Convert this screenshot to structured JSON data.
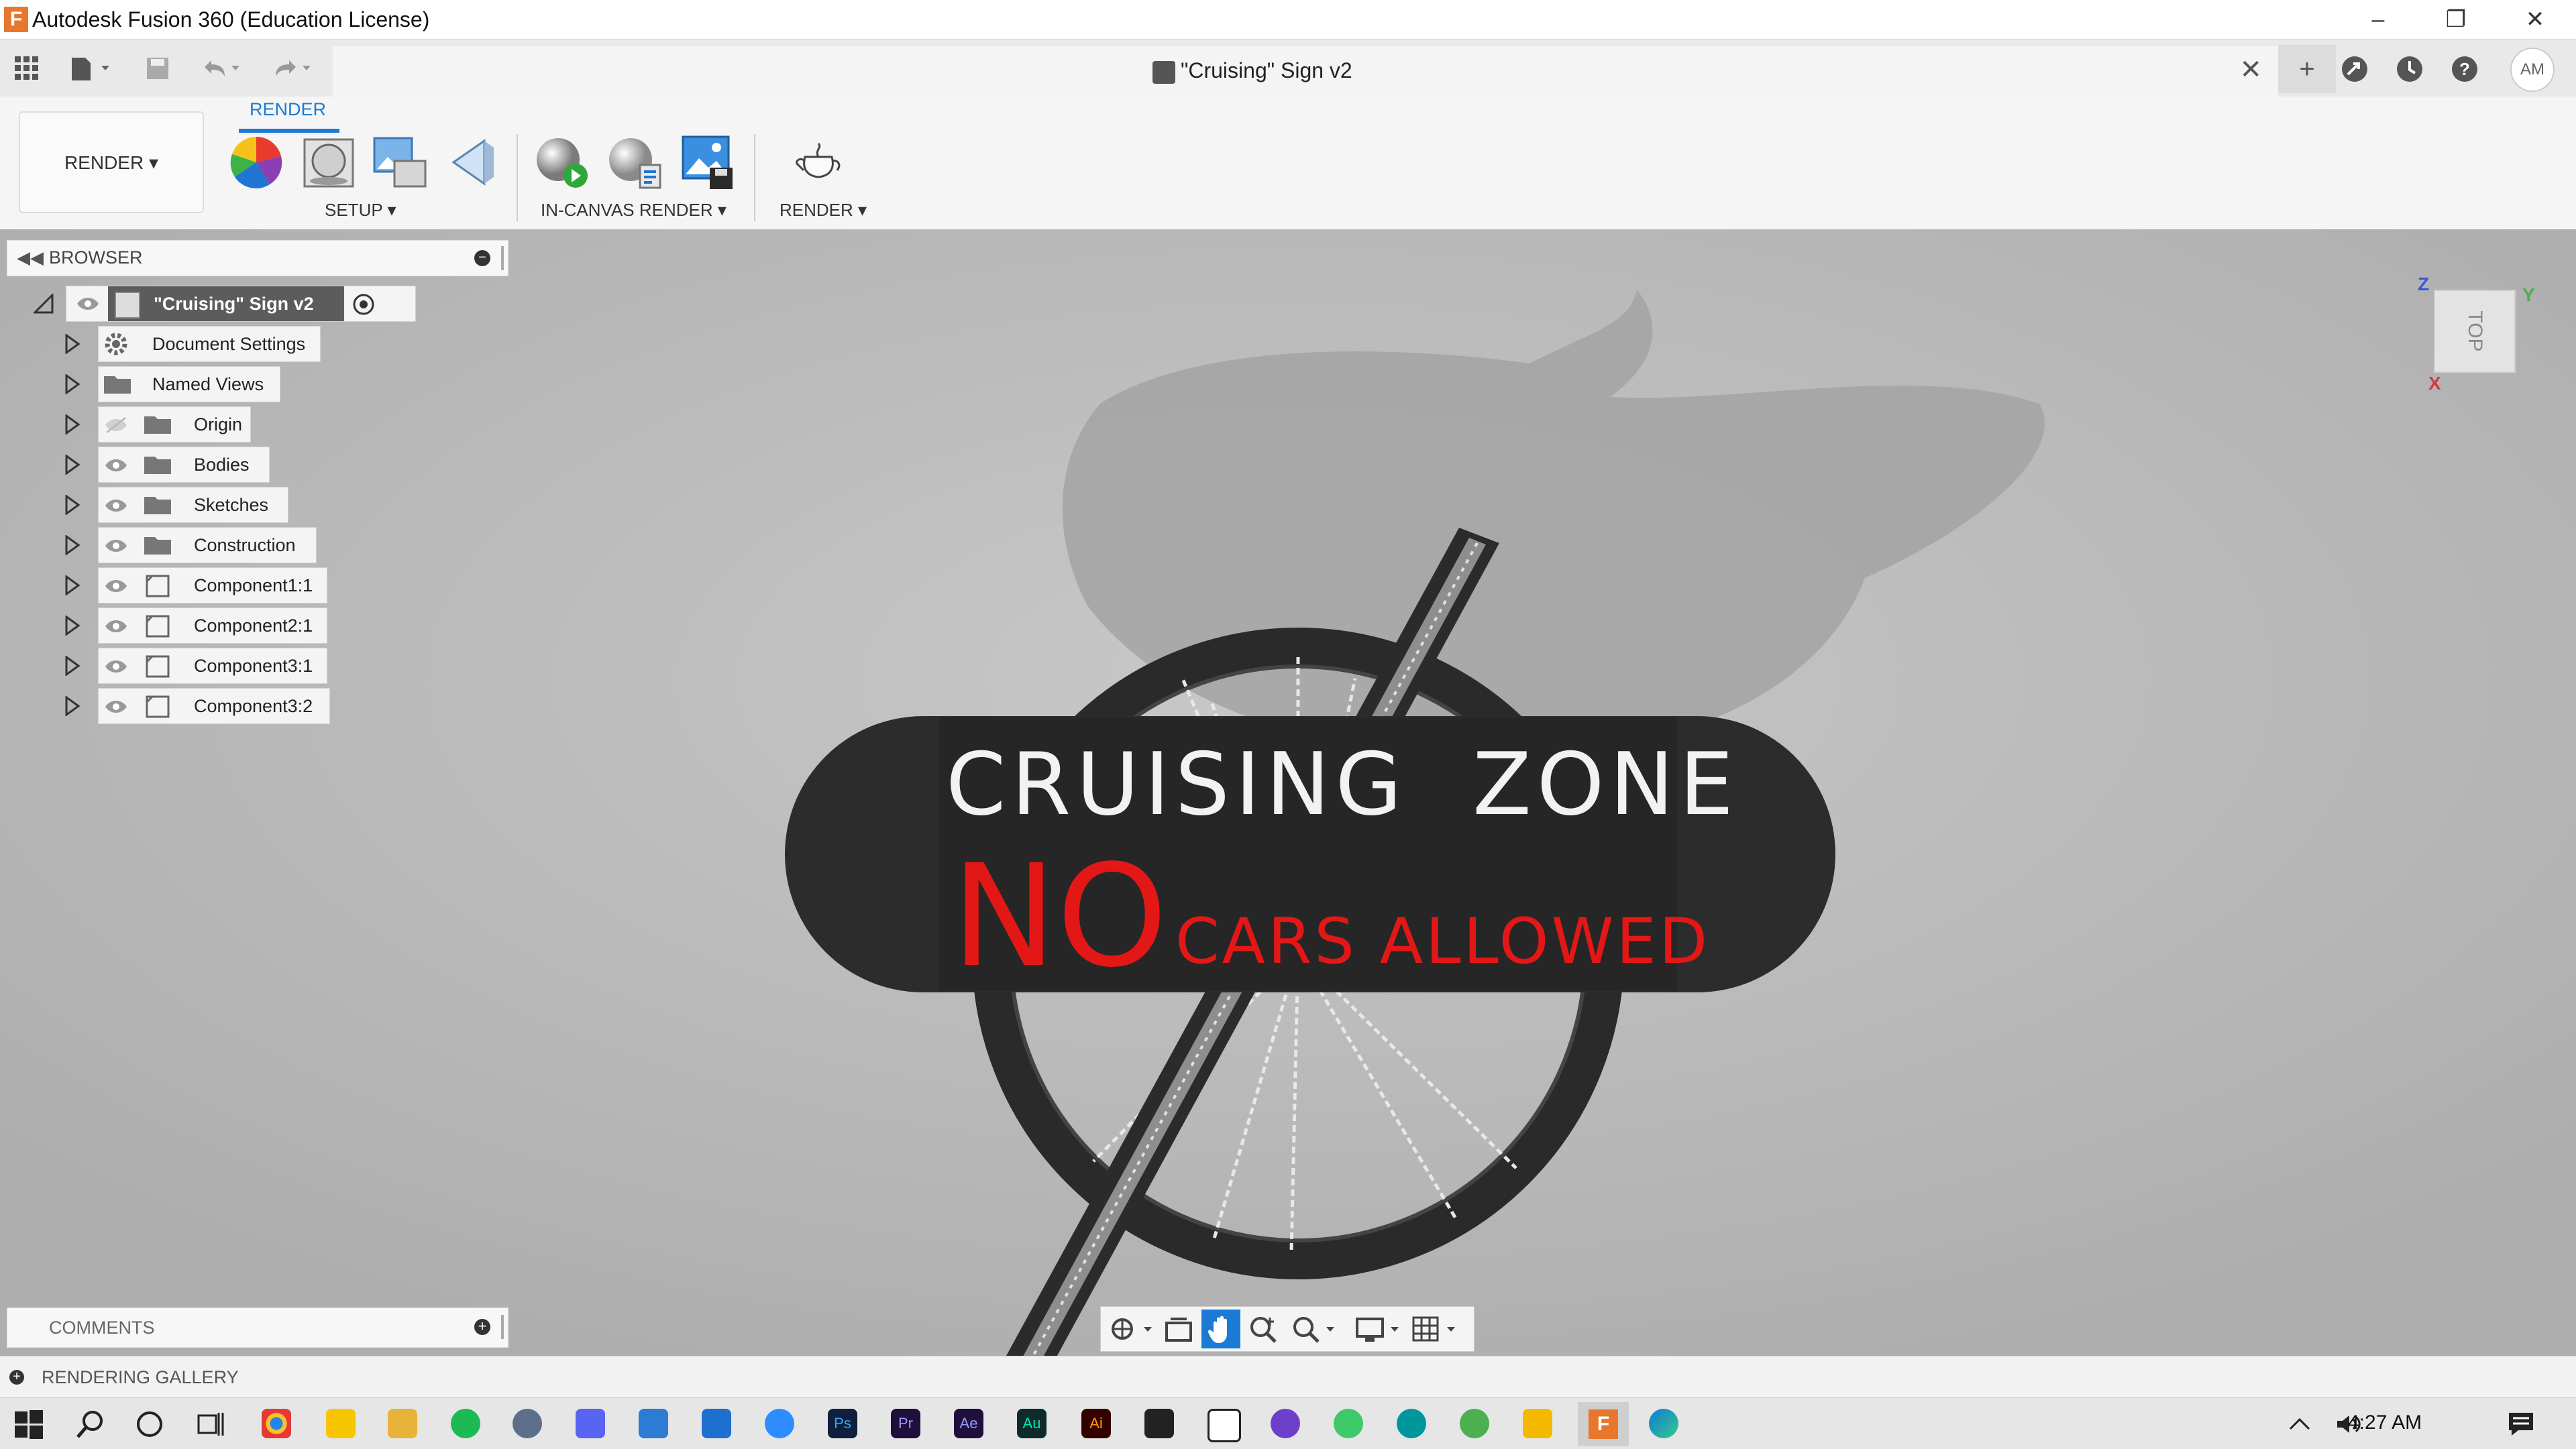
{
  "window": {
    "title": "Autodesk Fusion 360 (Education License)"
  },
  "document": {
    "title": "\"Cruising\" Sign v2"
  },
  "user": {
    "initials": "AM"
  },
  "ribbon": {
    "workspace": "RENDER ▾",
    "active_tab": "RENDER",
    "groups": [
      "SETUP ▾",
      "IN-CANVAS RENDER ▾",
      "RENDER ▾"
    ]
  },
  "browser": {
    "header": "BROWSER",
    "root": "\"Cruising\" Sign v2",
    "items": [
      {
        "label": "Document Settings",
        "icon": "gear-icon"
      },
      {
        "label": "Named Views",
        "icon": "folder-icon"
      },
      {
        "label": "Origin",
        "icon": "folder-icon"
      },
      {
        "label": "Bodies",
        "icon": "folder-icon"
      },
      {
        "label": "Sketches",
        "icon": "folder-icon"
      },
      {
        "label": "Construction",
        "icon": "folder-icon"
      },
      {
        "label": "Component1:1",
        "icon": "component-icon"
      },
      {
        "label": "Component2:1",
        "icon": "component-icon"
      },
      {
        "label": "Component3:1",
        "icon": "component-icon"
      },
      {
        "label": "Component3:2",
        "icon": "component-icon"
      }
    ]
  },
  "comments": {
    "label": "COMMENTS"
  },
  "gallery": {
    "label": "RENDERING GALLERY"
  },
  "sign": {
    "line1": "CRUISING  ZONE",
    "no": "NO",
    "line2": "CARS ALLOWED",
    "red": "#e41717"
  },
  "viewcube": {
    "face": "TOP",
    "axis_z": "Z",
    "axis_x": "X",
    "axis_y": "Y"
  },
  "taskbar": {
    "time": "4:27 AM"
  },
  "colors": {
    "accent": "#1b7bd4",
    "fusion_orange": "#e8772e"
  }
}
